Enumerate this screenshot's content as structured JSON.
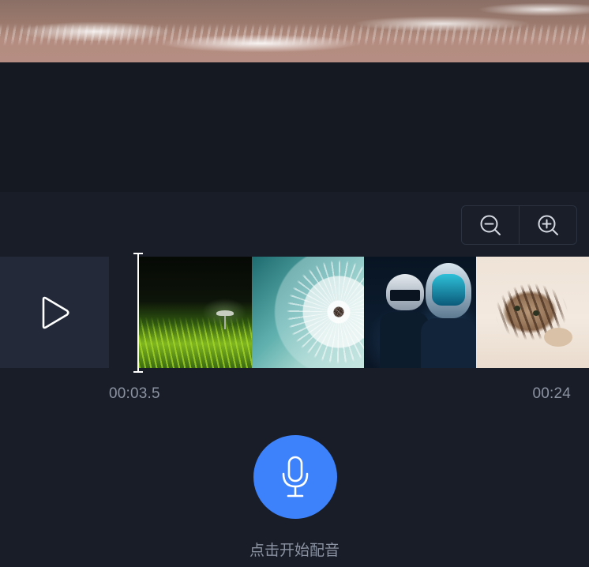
{
  "preview": {
    "image": "beach-shoreline"
  },
  "zoom": {
    "zoom_out_icon": "zoom-out-icon",
    "zoom_in_icon": "zoom-in-icon"
  },
  "timeline": {
    "play_icon": "play-icon",
    "thumbnails": [
      {
        "name": "grass-mushroom"
      },
      {
        "name": "dandelion"
      },
      {
        "name": "helmet-robots"
      },
      {
        "name": "cat"
      }
    ],
    "current_time": "00:03.5",
    "total_time": "00:24"
  },
  "record": {
    "icon": "microphone-icon",
    "label": "点击开始配音",
    "color": "#3d82fb"
  }
}
